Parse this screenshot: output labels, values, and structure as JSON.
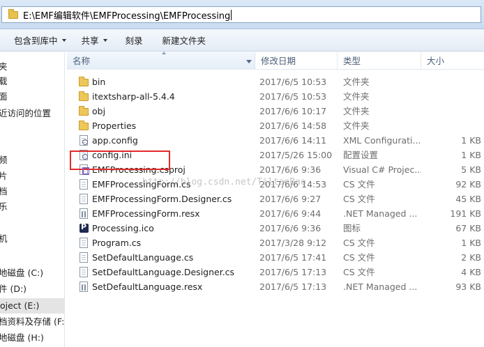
{
  "address_bar": {
    "path": "E:\\EMF编辑软件\\EMFProcessing\\EMFProcessing"
  },
  "toolbar": {
    "include_in_library": "包含到库中",
    "share": "共享",
    "burn": "刻录",
    "new_folder": "新建文件夹"
  },
  "nav_pane": {
    "items": [
      {
        "label": "夹",
        "icon": "folder-icon"
      },
      {
        "label": "载",
        "icon": "download-icon"
      },
      {
        "label": "面",
        "icon": "desktop-icon"
      },
      {
        "label": "近访问的位置",
        "icon": "recent-places-icon"
      },
      {
        "label": "",
        "icon": ""
      },
      {
        "label": "",
        "icon": ""
      },
      {
        "label": "频",
        "icon": "video-icon"
      },
      {
        "label": "片",
        "icon": "pictures-icon"
      },
      {
        "label": "档",
        "icon": "documents-icon"
      },
      {
        "label": "乐",
        "icon": "music-icon"
      },
      {
        "label": "",
        "icon": ""
      },
      {
        "label": "机",
        "icon": "computer-icon"
      },
      {
        "label": "地磁盘 (C:)",
        "icon": "drive-icon"
      },
      {
        "label": "件 (D:)",
        "icon": "drive-icon"
      },
      {
        "label": "oject (E:)",
        "icon": "drive-icon",
        "selected": true
      },
      {
        "label": "档资料及存储 (F:)",
        "icon": "drive-icon"
      },
      {
        "label": "地磁盘 (H:)",
        "icon": "drive-icon"
      }
    ]
  },
  "columns": {
    "name": "名称",
    "date": "修改日期",
    "type": "类型",
    "size": "大小"
  },
  "files": [
    {
      "name": "bin",
      "date": "2017/6/5 10:53",
      "type": "文件夹",
      "size": "",
      "icon": "folder-icon"
    },
    {
      "name": "itextsharp-all-5.4.4",
      "date": "2017/6/5 10:53",
      "type": "文件夹",
      "size": "",
      "icon": "folder-icon"
    },
    {
      "name": "obj",
      "date": "2017/6/6 10:17",
      "type": "文件夹",
      "size": "",
      "icon": "folder-icon"
    },
    {
      "name": "Properties",
      "date": "2017/6/6 14:58",
      "type": "文件夹",
      "size": "",
      "icon": "folder-icon"
    },
    {
      "name": "app.config",
      "date": "2017/6/6 14:11",
      "type": "XML Configurati...",
      "size": "1 KB",
      "icon": "config-file-icon"
    },
    {
      "name": "config.ini",
      "date": "2017/5/26 15:00",
      "type": "配置设置",
      "size": "1 KB",
      "icon": "config-file-icon"
    },
    {
      "name": "EMFProcessing.csproj",
      "date": "2017/6/6 9:36",
      "type": "Visual C# Projec...",
      "size": "5 KB",
      "icon": "csproj-file-icon"
    },
    {
      "name": "EMFProcessingForm.cs",
      "date": "2017/6/6 14:53",
      "type": "CS 文件",
      "size": "92 KB",
      "icon": "cs-file-icon"
    },
    {
      "name": "EMFProcessingForm.Designer.cs",
      "date": "2017/6/6 9:27",
      "type": "CS 文件",
      "size": "45 KB",
      "icon": "cs-file-icon"
    },
    {
      "name": "EMFProcessingForm.resx",
      "date": "2017/6/6 9:44",
      "type": ".NET Managed ...",
      "size": "191 KB",
      "icon": "resx-file-icon"
    },
    {
      "name": "Processing.ico",
      "date": "2017/6/6 9:36",
      "type": "图标",
      "size": "67 KB",
      "icon": "ico-file-icon"
    },
    {
      "name": "Program.cs",
      "date": "2017/3/28 9:12",
      "type": "CS 文件",
      "size": "1 KB",
      "icon": "cs-file-icon"
    },
    {
      "name": "SetDefaultLanguage.cs",
      "date": "2017/6/5 17:41",
      "type": "CS 文件",
      "size": "2 KB",
      "icon": "cs-file-icon"
    },
    {
      "name": "SetDefaultLanguage.Designer.cs",
      "date": "2017/6/5 17:13",
      "type": "CS 文件",
      "size": "4 KB",
      "icon": "cs-file-icon"
    },
    {
      "name": "SetDefaultLanguage.resx",
      "date": "2017/6/5 17:13",
      "type": ".NET Managed ...",
      "size": "93 KB",
      "icon": "resx-file-icon"
    }
  ],
  "watermark": "http://blog.csdn.net/TiltanBao",
  "highlight_color": "#e22a2a"
}
